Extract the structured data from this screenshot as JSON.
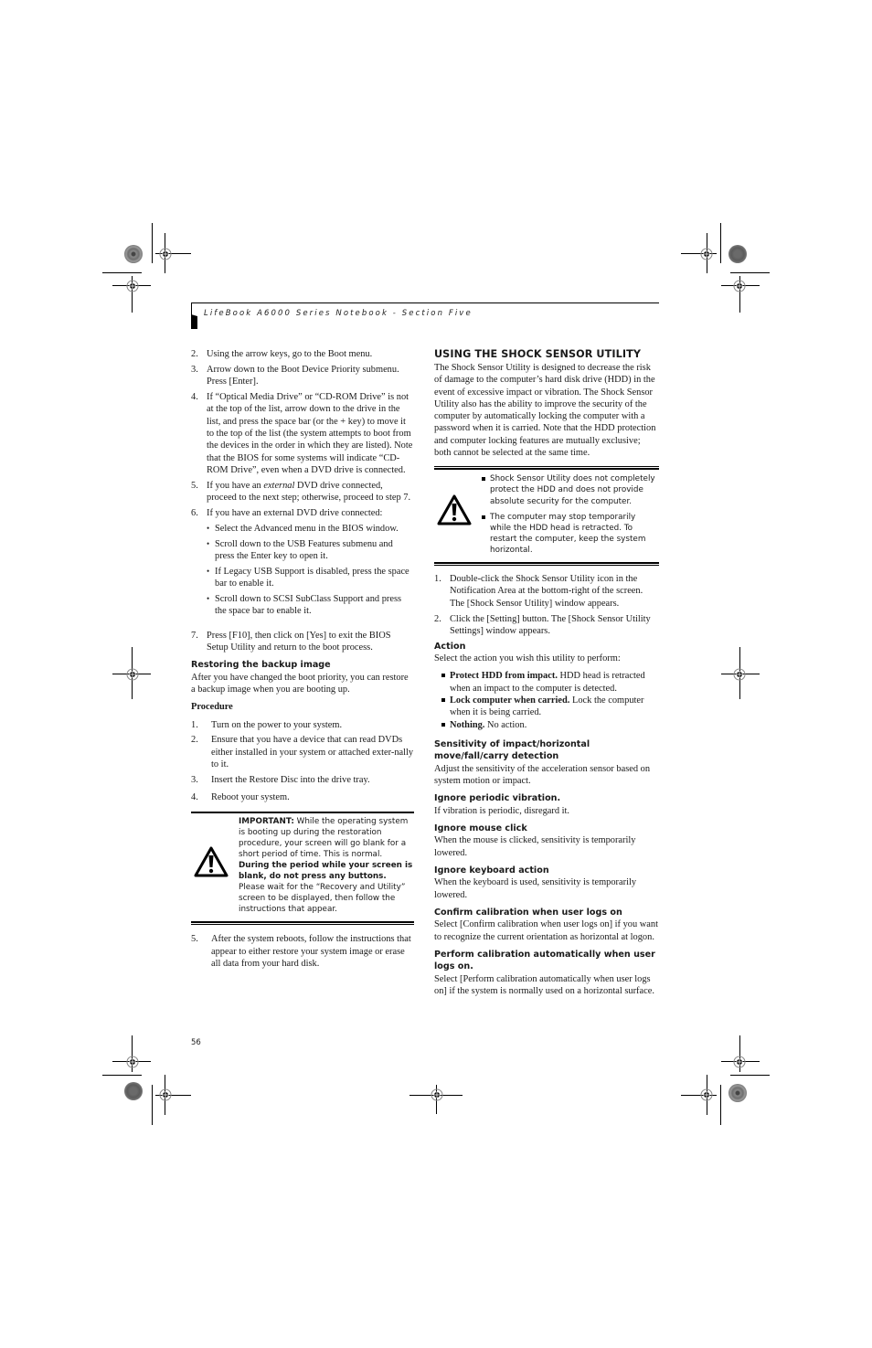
{
  "header": {
    "running_title": "LifeBook A6000 Series Notebook - Section Five"
  },
  "page_number": "56",
  "left_column": {
    "steps_top": [
      {
        "num": "2.",
        "text": "Using the arrow keys, go to the Boot menu."
      },
      {
        "num": "3.",
        "text": "Arrow down to the Boot Device Priority submenu. Press [Enter]."
      },
      {
        "num": "4.",
        "text": "If “Optical Media Drive” or “CD-ROM Drive” is not at the top of the list, arrow down to the drive in the list, and press the space bar (or the + key) to move it to the top of the list (the system attempts to boot from the devices in the order in which they are listed). Note that the BIOS for some systems will indicate “CD-ROM Drive”, even when a DVD drive is connected."
      },
      {
        "num": "5.",
        "text_before": "If you have an ",
        "text_italic": "external",
        "text_after": " DVD drive connected, proceed to the next step; otherwise, proceed to step 7."
      },
      {
        "num": "6.",
        "text": "If you have an external DVD drive connected:"
      }
    ],
    "step6_bullets": [
      "Select the Advanced menu in the BIOS window.",
      "Scroll down to the USB Features submenu and press the Enter key to open it.",
      "If Legacy USB Support is disabled, press the space bar to enable it.",
      "Scroll down to SCSI SubClass Support and press the space bar to enable it."
    ],
    "step7": {
      "num": "7.",
      "text": "Press [F10], then click on [Yes] to exit the BIOS Setup Utility and return to the boot process."
    },
    "restoring": {
      "heading": "Restoring the backup image",
      "intro": "After you have changed the boot priority, you can restore a backup image when you are booting up.",
      "procedure_label": "Procedure",
      "steps": [
        {
          "num": "1.",
          "text": "Turn on the power to your system."
        },
        {
          "num": "2.",
          "text": "Ensure that you have a device that can read DVDs either installed in your system or attached exter-nally to it."
        },
        {
          "num": "3.",
          "text": "Insert the Restore Disc into the drive tray."
        },
        {
          "num": "4.",
          "text": "Reboot your system."
        }
      ],
      "important": {
        "label": "IMPORTANT:",
        "text1": " While the operating system is booting up during the restoration procedure, your screen will go blank for a short period of time. This is normal. ",
        "bold": "During the period while your screen is blank, do not press any buttons.",
        "text2": " Please wait for the “Recovery and Utility” screen to be displayed, then follow the instructions that appear.",
        "icon": "warning-triangle-icon"
      },
      "step5": {
        "num": "5.",
        "text": "After the system reboots, follow the instructions that appear to either restore your system image or erase all data from your hard disk."
      }
    }
  },
  "right_column": {
    "heading": "USING THE SHOCK SENSOR UTILITY",
    "intro": "The Shock Sensor Utility is designed to decrease the risk of damage to the computer’s hard disk drive (HDD) in the event of excessive impact or vibration. The Shock Sensor Utility also has the ability to improve the security of the computer by automatically locking the computer with a password when it is carried. Note that the HDD protection and computer locking features are mutually exclusive; both cannot be selected at the same time.",
    "caution": {
      "icon": "warning-triangle-icon",
      "items": [
        "Shock Sensor Utility does not completely protect the HDD and does not provide absolute security for the computer.",
        "The computer may stop temporarily while the HDD head is retracted. To restart the computer, keep the system horizontal."
      ]
    },
    "steps": [
      {
        "num": "1.",
        "text": "Double-click the Shock Sensor Utility icon in the Notification Area at the bottom-right of the screen. The [Shock Sensor Utility] window appears."
      },
      {
        "num": "2.",
        "text": "Click the [Setting] button. The [Shock Sensor Utility Settings] window appears."
      }
    ],
    "action": {
      "heading": "Action",
      "intro": "Select the action you wish this utility to perform:",
      "options": [
        {
          "bold": "Protect HDD from impact.",
          "text": " HDD head is retracted when an impact to the computer is detected."
        },
        {
          "bold": "Lock computer when carried.",
          "text": " Lock the computer when it is being carried."
        },
        {
          "bold": "Nothing.",
          "text": " No action."
        }
      ]
    },
    "settings": [
      {
        "heading": "Sensitivity of impact/horizontal move/fall/carry detection",
        "text": "Adjust the sensitivity of the acceleration sensor based on system motion or impact."
      },
      {
        "heading": "Ignore periodic vibration.",
        "text": "If vibration is periodic, disregard it."
      },
      {
        "heading": "Ignore mouse click",
        "text": "When the mouse is clicked, sensitivity is temporarily lowered."
      },
      {
        "heading": "Ignore keyboard action",
        "text": "When the keyboard is used, sensitivity is temporarily lowered."
      },
      {
        "heading": "Confirm calibration when user logs on",
        "text": "Select [Confirm calibration when user logs on] if you want to recognize the current orientation as horizontal at logon."
      },
      {
        "heading": "Perform calibration automatically when user logs on.",
        "text": "Select [Perform calibration automatically when user logs on] if the system is normally used on a horizontal surface."
      }
    ]
  }
}
